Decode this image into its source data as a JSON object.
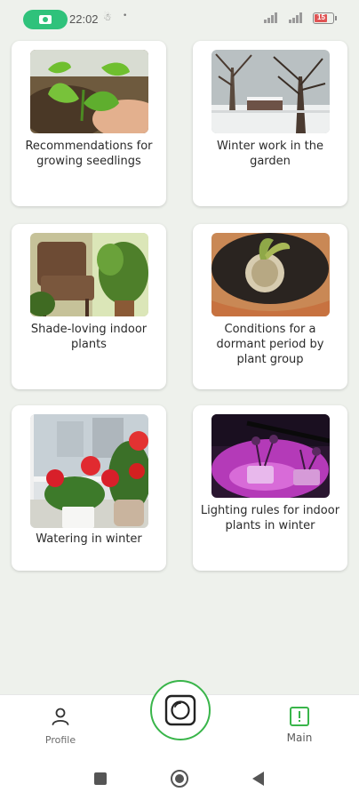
{
  "status_bar": {
    "time": "22:02",
    "battery": "15",
    "colors": {
      "recording": "#2fc27b",
      "battery_low": "#e05454"
    }
  },
  "cards": [
    {
      "title": "Recommendations for growing seedlings",
      "image": "seedling-photo"
    },
    {
      "title": "Winter work in the garden",
      "image": "snowy-garden-photo"
    },
    {
      "title": "Shade-loving indoor plants",
      "image": "indoor-plants-photo"
    },
    {
      "title": "Conditions for a dormant period by plant group",
      "image": "bulb-in-pot-photo"
    },
    {
      "title": "Watering in winter",
      "image": "geraniums-window-photo"
    },
    {
      "title": "Lighting rules for indoor plants in winter",
      "image": "grow-light-photo"
    }
  ],
  "bottom_nav": {
    "profile_label": "Profile",
    "main_label": "Main",
    "center_action": "camera-scan",
    "accent": "#39b54a"
  }
}
